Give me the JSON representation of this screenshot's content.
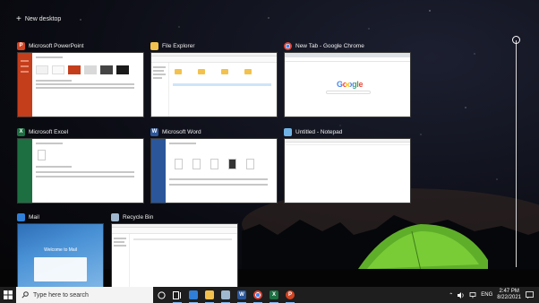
{
  "new_desktop": {
    "plus": "+",
    "label": "New desktop"
  },
  "windows": [
    {
      "title": "Microsoft PowerPoint",
      "icon": "P",
      "icon_color": "#d04423"
    },
    {
      "title": "File Explorer",
      "icon": "",
      "icon_color": "#f2c14e"
    },
    {
      "title": "New Tab - Google Chrome",
      "icon": "",
      "icon_color": "#4285f4"
    },
    {
      "title": "Microsoft Excel",
      "icon": "X",
      "icon_color": "#1d6f42"
    },
    {
      "title": "Microsoft Word",
      "icon": "W",
      "icon_color": "#2b579a"
    },
    {
      "title": "Untitled - Notepad",
      "icon": "",
      "icon_color": "#6fb3e6"
    },
    {
      "title": "Mail",
      "icon": "",
      "icon_color": "#2f7fd8"
    },
    {
      "title": "Recycle Bin",
      "icon": "",
      "icon_color": "#9fb8cf"
    }
  ],
  "chrome_thumb": {
    "logo": "Google"
  },
  "mail_thumb": {
    "welcome": "Welcome to Mail"
  },
  "taskbar": {
    "search_placeholder": "Type here to search",
    "language": "ENG",
    "time": "2:47 PM",
    "date": "8/22/2021",
    "pinned": [
      "task-view",
      "mail",
      "file-explorer",
      "recycle",
      "word",
      "chrome",
      "excel",
      "powerpoint"
    ]
  },
  "colors": {
    "accent": "#7fb3ea",
    "taskbar": "#1e1e1e"
  }
}
